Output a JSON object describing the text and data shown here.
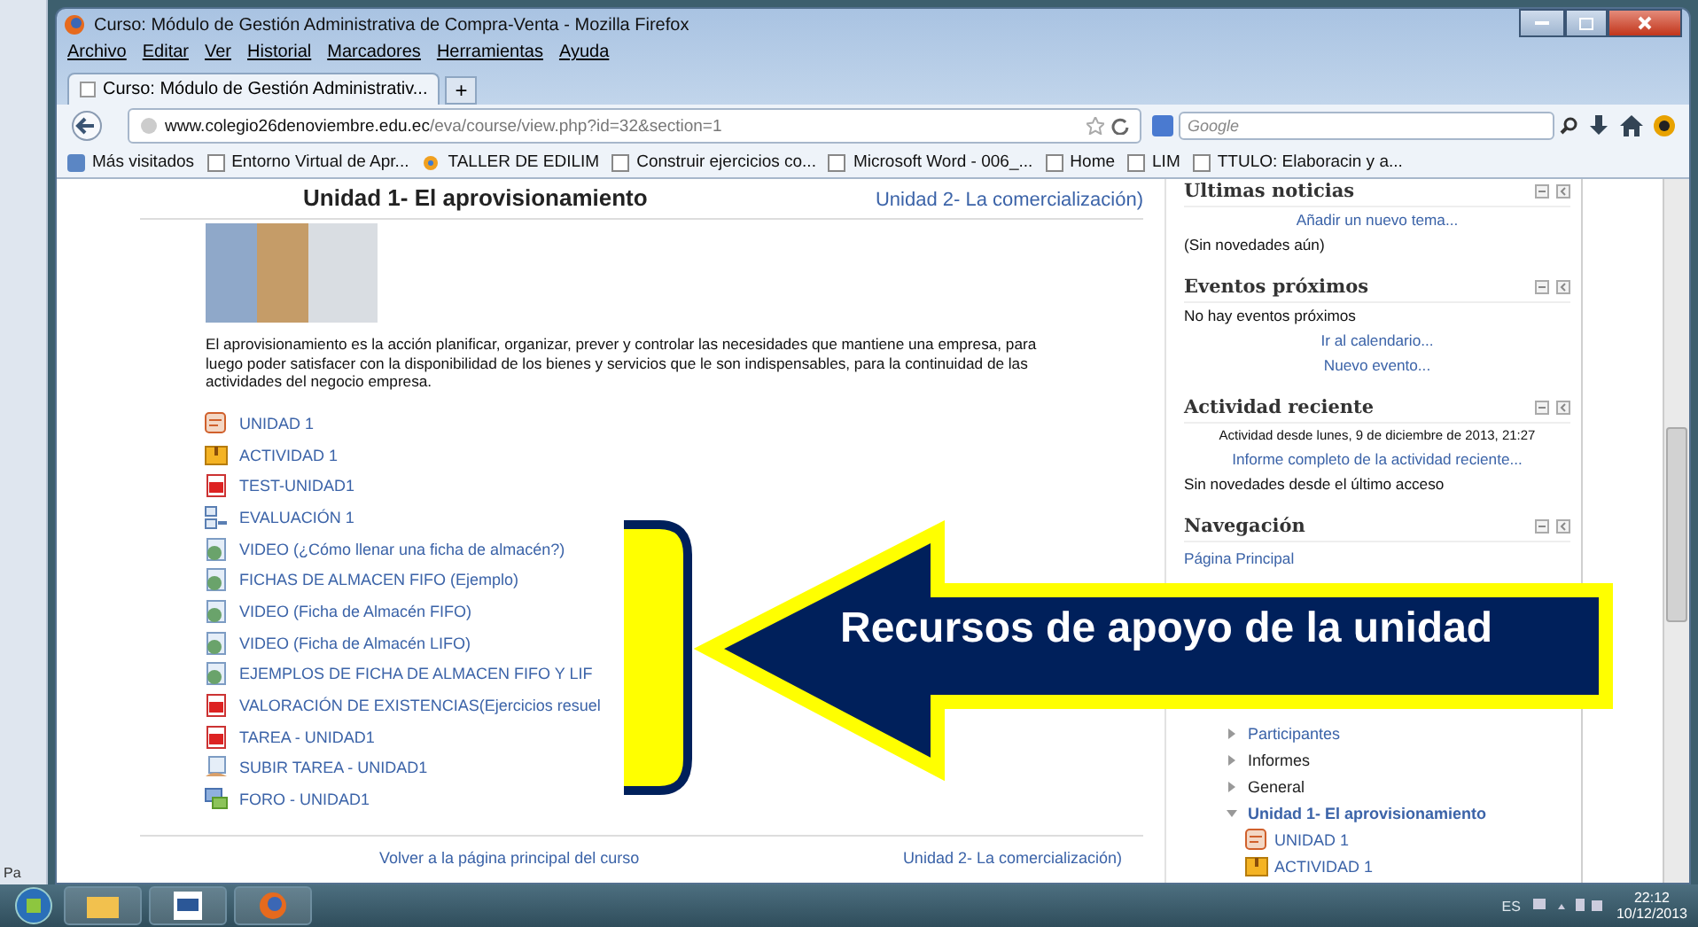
{
  "window": {
    "title": "Curso: Módulo de Gestión Administrativa de Compra-Venta - Mozilla Firefox"
  },
  "menu": [
    "Archivo",
    "Editar",
    "Ver",
    "Historial",
    "Marcadores",
    "Herramientas",
    "Ayuda"
  ],
  "tabs": [
    {
      "label": "Curso: Módulo de Gestión Administrativ...",
      "selected": true
    }
  ],
  "new_tab": "+",
  "address_bar": {
    "url_host": "www.colegio26denoviembre.edu.ec",
    "url_path": "/eva/course/view.php?id=32&section=1"
  },
  "search_field": {
    "placeholder": "Google"
  },
  "bookmarks": [
    {
      "label": "Más visitados",
      "kind": "smart"
    },
    {
      "label": "Entorno Virtual de Apr...",
      "kind": "page"
    },
    {
      "label": "TALLER DE EDILIM",
      "kind": "app"
    },
    {
      "label": "Construir ejercicios co...",
      "kind": "page"
    },
    {
      "label": "Microsoft Word - 006_...",
      "kind": "page"
    },
    {
      "label": "Home",
      "kind": "page"
    },
    {
      "label": "LIM",
      "kind": "page"
    },
    {
      "label": "TTULO: Elaboracin y a...",
      "kind": "page"
    }
  ],
  "document_side": {
    "label": "Pa"
  },
  "main": {
    "title": "Unidad 1- El aprovisionamiento",
    "next_link": "Unidad 2- La comercialización)",
    "description": "El aprovisionamiento es la acción planificar, organizar, prever y controlar las necesidades que mantiene una empresa, para luego poder satisfacer con la disponibilidad de los bienes y servicios que le son indispensables, para la continuidad de las actividades del negocio empresa.",
    "resources": [
      {
        "kind": "page",
        "label": "UNIDAD 1"
      },
      {
        "kind": "assignment",
        "label": "ACTIVIDAD 1"
      },
      {
        "kind": "pdf",
        "label": "TEST-UNIDAD1"
      },
      {
        "kind": "quiz",
        "label": "EVALUACIÓN 1"
      },
      {
        "kind": "url",
        "label": "VIDEO (¿Cómo llenar una ficha de almacén?)"
      },
      {
        "kind": "url",
        "label": "FICHAS DE ALMACEN FIFO (Ejemplo)"
      },
      {
        "kind": "url",
        "label": "VIDEO (Ficha de Almacén FIFO)"
      },
      {
        "kind": "url",
        "label": "VIDEO (Ficha de Almacén LIFO)"
      },
      {
        "kind": "url",
        "label": "EJEMPLOS DE FICHA DE ALMACEN FIFO Y LIF"
      },
      {
        "kind": "pdf",
        "label": "VALORACIÓN DE EXISTENCIAS(Ejercicios resuel"
      },
      {
        "kind": "pdf",
        "label": "TAREA - UNIDAD1"
      },
      {
        "kind": "upload",
        "label": "SUBIR TAREA - UNIDAD1"
      },
      {
        "kind": "forum",
        "label": "FORO - UNIDAD1"
      }
    ],
    "footer_links": [
      "Volver a la página principal del curso",
      "Unidad 2- La comercialización)"
    ]
  },
  "sidebar": {
    "blocks": [
      {
        "title": "Ultimas noticias",
        "lines": [
          {
            "kind": "link",
            "text": "Añadir un nuevo tema..."
          },
          {
            "kind": "text",
            "text": "(Sin novedades aún)"
          }
        ]
      },
      {
        "title": "Eventos próximos",
        "lines": [
          {
            "kind": "text",
            "text": "No hay eventos próximos"
          },
          {
            "kind": "link",
            "text": "Ir al calendario..."
          },
          {
            "kind": "link",
            "text": "Nuevo evento..."
          }
        ]
      },
      {
        "title": "Actividad reciente",
        "lines": [
          {
            "kind": "note",
            "text": "Actividad desde lunes, 9 de diciembre de 2013, 21:27"
          },
          {
            "kind": "link",
            "text": "Informe completo de la actividad reciente..."
          },
          {
            "kind": "text",
            "text": "Sin novedades desde el último acceso"
          }
        ]
      }
    ],
    "navigation": {
      "title": "Navegación",
      "home": "Página Principal",
      "tree": [
        {
          "label": "Participantes",
          "kind": "link",
          "expanded": false
        },
        {
          "label": "Informes",
          "kind": "text",
          "expanded": false
        },
        {
          "label": "General",
          "kind": "text",
          "expanded": false
        },
        {
          "label": "Unidad 1- El aprovisionamiento",
          "kind": "current",
          "expanded": true,
          "children": [
            {
              "label": "UNIDAD 1",
              "kind": "page"
            },
            {
              "label": "ACTIVIDAD 1",
              "kind": "assignment"
            }
          ]
        }
      ]
    }
  },
  "callout": {
    "label": "Recursos de apoyo de la unidad"
  },
  "taskbar": {
    "language": "ES",
    "time": "22:12",
    "date": "10/12/2013"
  }
}
